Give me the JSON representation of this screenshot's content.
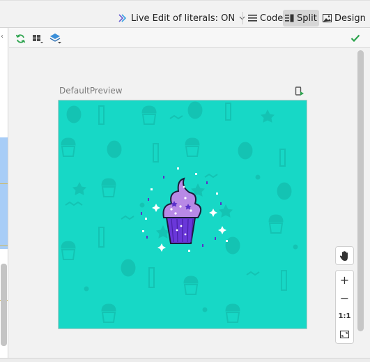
{
  "toolbar": {
    "live_edit_label": "Live Edit of literals: ON",
    "code_label": "Code",
    "split_label": "Split",
    "design_label": "Design"
  },
  "preview": {
    "name": "DefaultPreview",
    "background_color": "#17d8c6",
    "cupcake_frosting_color": "#b889e6",
    "cupcake_cup_color": "#6a37d9"
  },
  "zoom": {
    "zoom_in_label": "+",
    "zoom_out_label": "−",
    "actual_size_label": "1:1"
  },
  "icons": {
    "live_edit": "live-edit-icon",
    "code": "code-view-icon",
    "split": "split-view-icon",
    "design": "design-view-icon",
    "refresh": "refresh-icon",
    "device": "device-layout-icon",
    "layers": "layers-icon",
    "check": "check-icon",
    "deploy": "deploy-to-device-icon",
    "pan": "hand-pan-icon",
    "zoom_to_fit": "zoom-to-fit-icon"
  }
}
